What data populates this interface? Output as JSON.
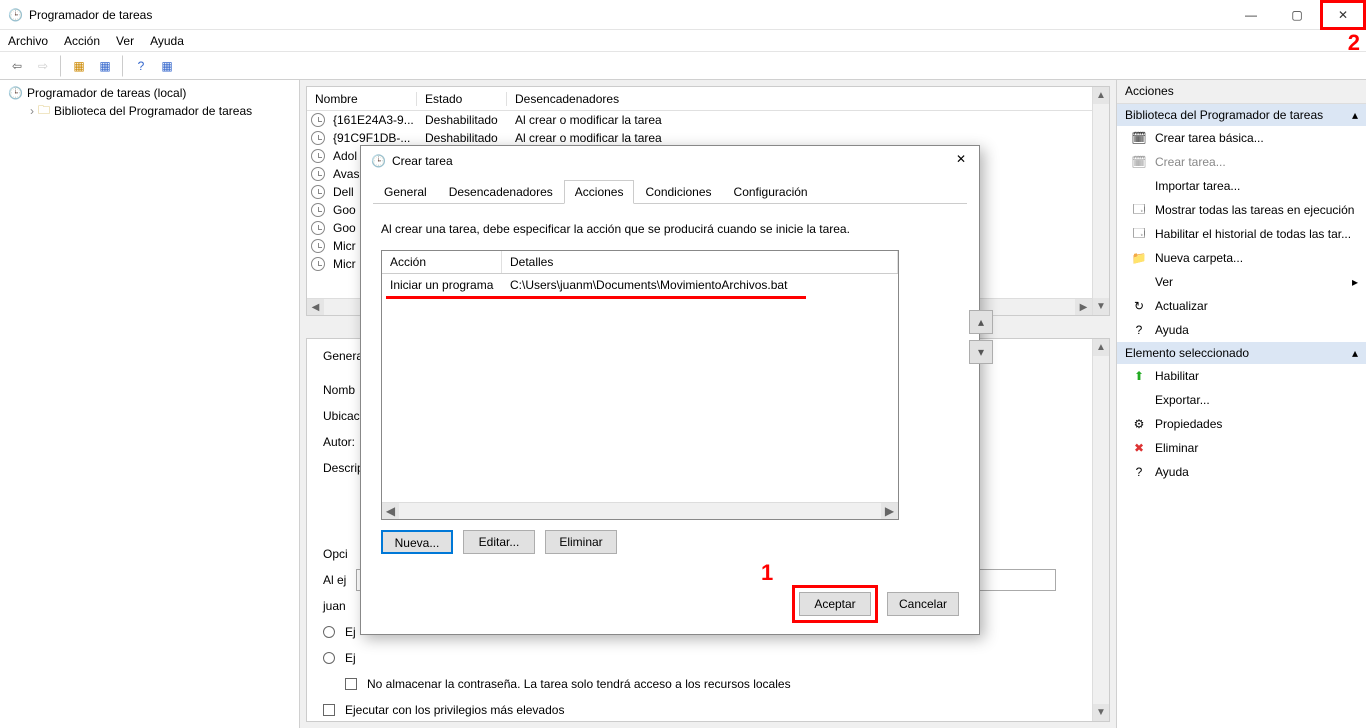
{
  "window": {
    "title": "Programador de tareas",
    "annotation_2": "2"
  },
  "menu": {
    "file": "Archivo",
    "action": "Acción",
    "view": "Ver",
    "help": "Ayuda"
  },
  "tree": {
    "root": "Programador de tareas (local)",
    "lib": "Biblioteca del Programador de tareas"
  },
  "tasklist": {
    "headers": {
      "name": "Nombre",
      "state": "Estado",
      "triggers": "Desencadenadores"
    },
    "rows": [
      {
        "name": "{161E24A3-9...",
        "state": "Deshabilitado",
        "triggers": "Al crear o modificar la tarea"
      },
      {
        "name": "{91C9F1DB-...",
        "state": "Deshabilitado",
        "triggers": "Al crear o modificar la tarea"
      },
      {
        "name": "Adol",
        "state": "",
        "triggers": ""
      },
      {
        "name": "Avas",
        "state": "",
        "triggers": ""
      },
      {
        "name": "Dell",
        "state": "",
        "triggers": ""
      },
      {
        "name": "Goo",
        "state": "",
        "triggers": ""
      },
      {
        "name": "Goo",
        "state": "",
        "triggers": ""
      },
      {
        "name": "Micr",
        "state": "",
        "triggers": ""
      },
      {
        "name": "Micr",
        "state": "",
        "triggers": ""
      }
    ]
  },
  "bottom": {
    "general_tab": "Genera",
    "name_label": "Nomb",
    "location_label": "Ubicac",
    "author_label": "Autor:",
    "desc_label": "Descrip",
    "opts_label": "Opci",
    "line1a": "Al ej",
    "line1b": "juan",
    "radio_a": "Ej",
    "radio_b": "Ej",
    "chk1": "No almacenar la contraseña. La tarea solo tendrá acceso a los recursos locales",
    "chk2": "Ejecutar con los privilegios más elevados"
  },
  "actions": {
    "title": "Acciones",
    "section1": "Biblioteca del Programador de tareas",
    "items1": [
      {
        "icon": "🗓",
        "label": "Crear tarea básica...",
        "disabled": false
      },
      {
        "icon": "🗓",
        "label": "Crear tarea...",
        "disabled": true
      },
      {
        "icon": "",
        "label": "Importar tarea...",
        "disabled": false
      },
      {
        "icon": "🗔",
        "label": "Mostrar todas las tareas en ejecución",
        "disabled": false
      },
      {
        "icon": "🗔",
        "label": "Habilitar el historial de todas las tar...",
        "disabled": false
      },
      {
        "icon": "📁",
        "label": "Nueva carpeta...",
        "disabled": false
      },
      {
        "icon": "",
        "label": "Ver",
        "disabled": false,
        "arrow": true
      },
      {
        "icon": "↻",
        "label": "Actualizar",
        "disabled": false
      },
      {
        "icon": "?",
        "label": "Ayuda",
        "disabled": false
      }
    ],
    "section2": "Elemento seleccionado",
    "items2": [
      {
        "icon": "⬆",
        "label": "Habilitar",
        "color": "#2a2"
      },
      {
        "icon": "",
        "label": "Exportar..."
      },
      {
        "icon": "⚙",
        "label": "Propiedades"
      },
      {
        "icon": "✖",
        "label": "Eliminar",
        "color": "#d33"
      },
      {
        "icon": "?",
        "label": "Ayuda"
      }
    ]
  },
  "dialog": {
    "title": "Crear tarea",
    "tabs": {
      "general": "General",
      "triggers": "Desencadenadores",
      "actions": "Acciones",
      "conditions": "Condiciones",
      "settings": "Configuración"
    },
    "desc": "Al crear una tarea, debe especificar la acción que se producirá cuando se inicie la tarea.",
    "table": {
      "col_action": "Acción",
      "col_details": "Detalles",
      "row_action": "Iniciar un programa",
      "row_details": "C:\\Users\\juanm\\Documents\\MovimientoArchivos.bat"
    },
    "btn_new": "Nueva...",
    "btn_edit": "Editar...",
    "btn_del": "Eliminar",
    "btn_ok": "Aceptar",
    "btn_cancel": "Cancelar",
    "annotation_1": "1"
  }
}
